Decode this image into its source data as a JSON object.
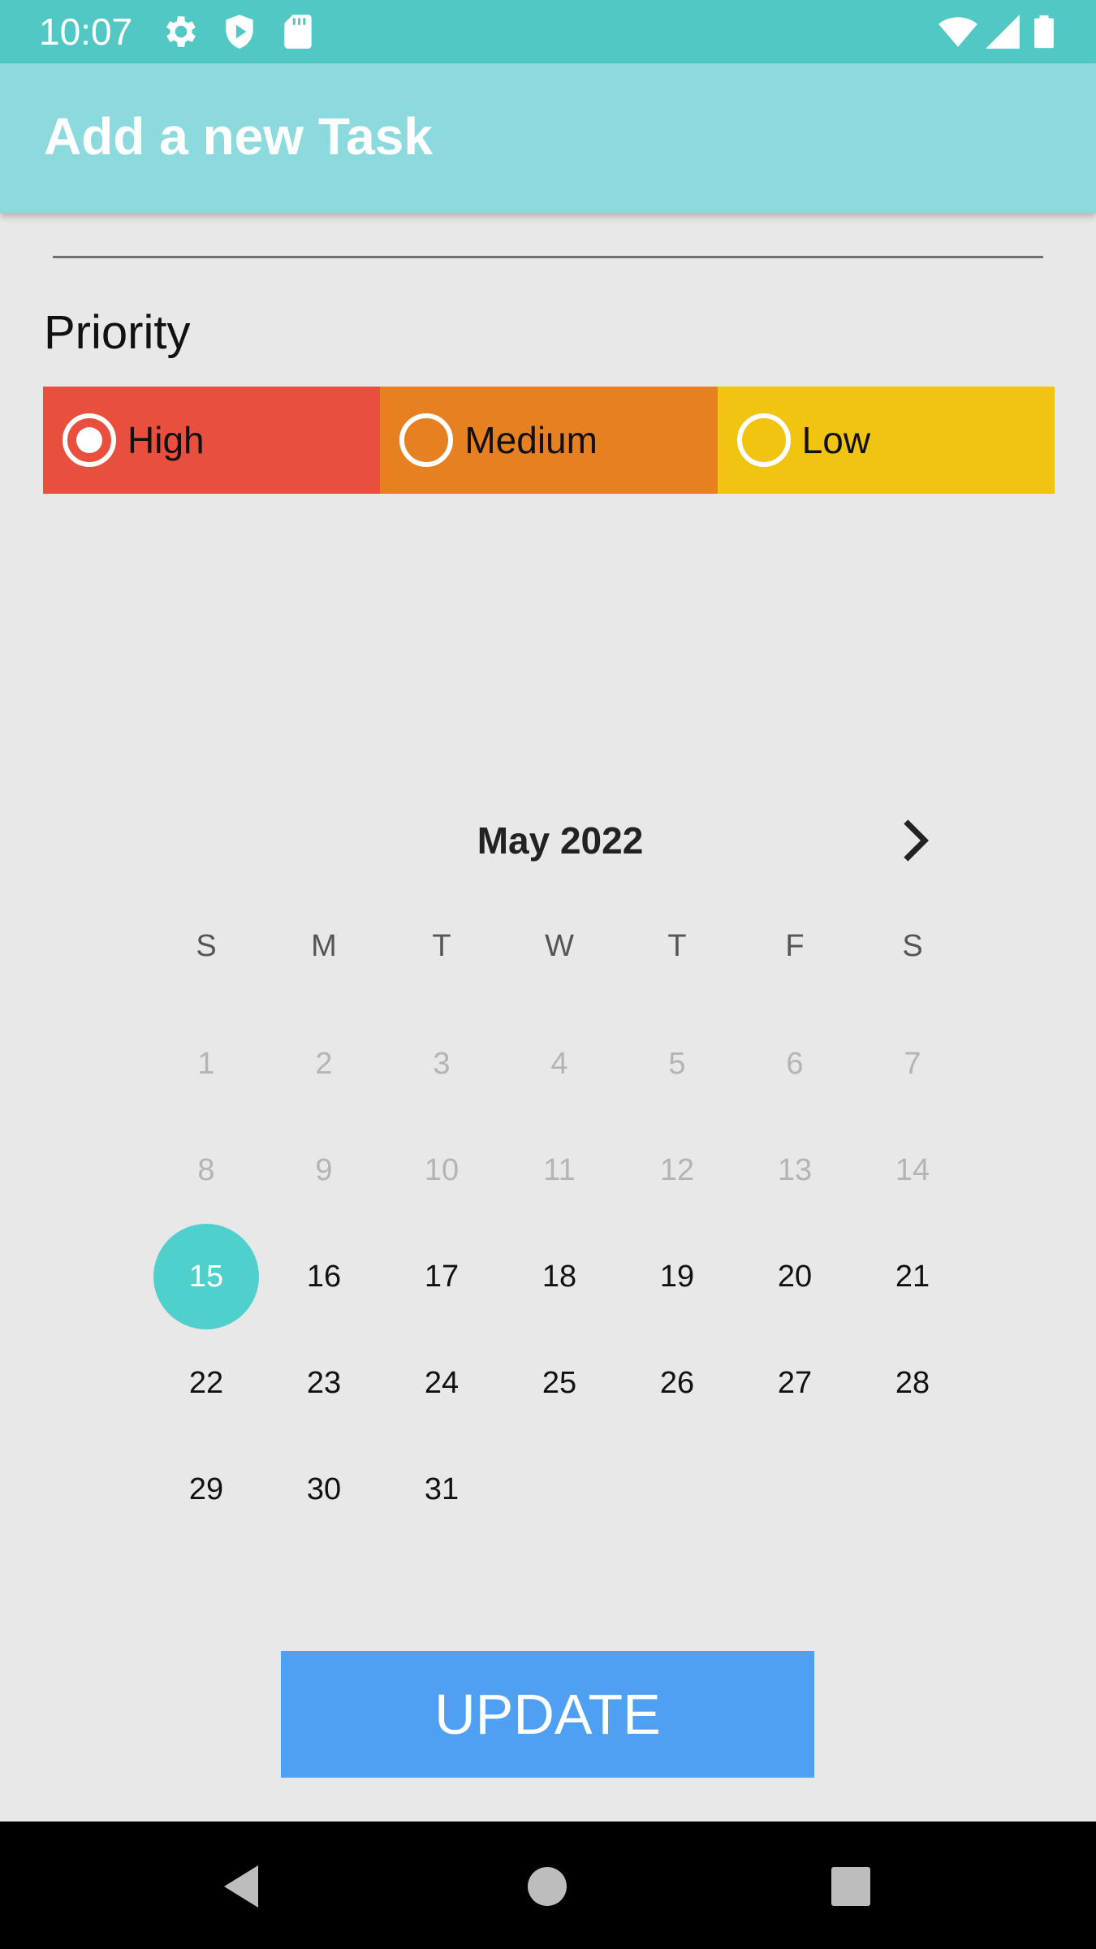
{
  "status_bar": {
    "time": "10:07",
    "icons": [
      "gear-icon",
      "shield-icon",
      "sd-card-icon",
      "wifi-icon",
      "cell-signal-icon",
      "battery-icon"
    ],
    "color": "#52c8c4"
  },
  "app_bar": {
    "title": "Add a new Task",
    "color": "#8cdade"
  },
  "priority": {
    "label": "Priority",
    "options": [
      {
        "label": "High",
        "color": "#e84f3d",
        "selected": true
      },
      {
        "label": "Medium",
        "color": "#e68021",
        "selected": false
      },
      {
        "label": "Low",
        "color": "#f1c411",
        "selected": false
      }
    ]
  },
  "calendar": {
    "month_title": "May 2022",
    "next_icon": "chevron-right-icon",
    "weekdays": [
      "S",
      "M",
      "T",
      "W",
      "T",
      "F",
      "S"
    ],
    "days": [
      "1",
      "2",
      "3",
      "4",
      "5",
      "6",
      "7",
      "8",
      "9",
      "10",
      "11",
      "12",
      "13",
      "14",
      "15",
      "16",
      "17",
      "18",
      "19",
      "20",
      "21",
      "22",
      "23",
      "24",
      "25",
      "26",
      "27",
      "28",
      "29",
      "30",
      "31"
    ],
    "selected_day": "15",
    "disabled_before": "15",
    "selected_color": "#4fd0cc"
  },
  "update_button": {
    "label": "UPDATE",
    "color": "#4fa0f2"
  },
  "nav_bar": {
    "icons": [
      "back-icon",
      "home-icon",
      "recents-icon"
    ]
  }
}
